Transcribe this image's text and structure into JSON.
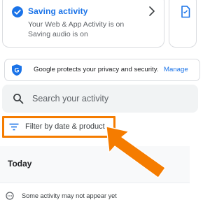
{
  "saving_card": {
    "title": "Saving activity",
    "line1": "Your Web & App Activity is on",
    "line2": "Saving audio is on"
  },
  "privacy_banner": {
    "text": "Google protects your privacy and security.",
    "link": "Manage"
  },
  "search": {
    "placeholder": "Search your activity"
  },
  "filter": {
    "label": "Filter by date & product"
  },
  "today": {
    "label": "Today"
  },
  "notice": {
    "text": "Some activity may not appear yet"
  },
  "colors": {
    "accent_blue": "#1a73e8",
    "highlight_orange": "#f57c00"
  }
}
